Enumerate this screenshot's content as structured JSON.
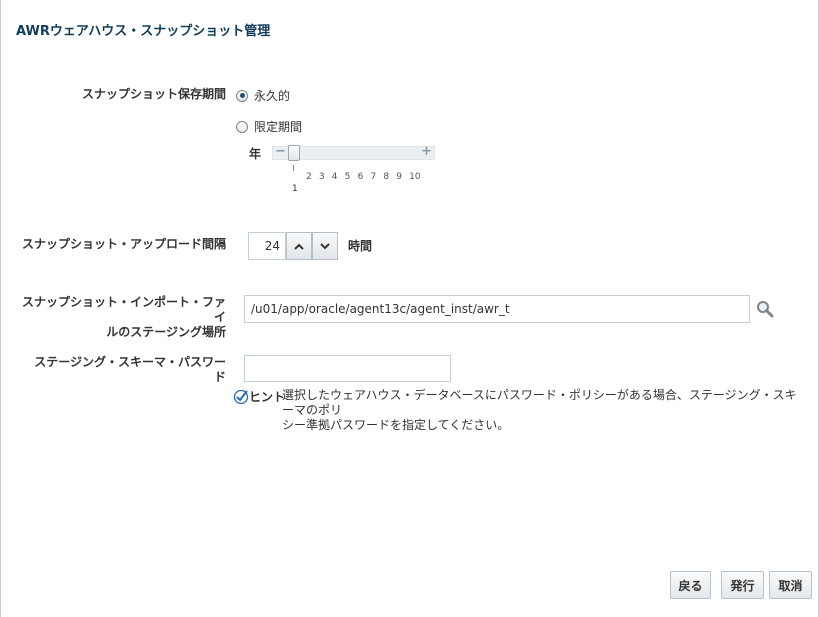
{
  "page": {
    "title": "AWRウェアハウス・スナップショット管理"
  },
  "retention": {
    "label": "スナップショット保存期間",
    "options": [
      {
        "label": "永久的",
        "selected": true
      },
      {
        "label": "限定期間",
        "selected": false
      }
    ],
    "slider": {
      "unit_label": "年",
      "minus_icon": "minus-icon",
      "plus_icon": "plus-icon",
      "ticks": [
        "2",
        "3",
        "4",
        "5",
        "6",
        "7",
        "8",
        "9",
        "10"
      ],
      "selected_value": "1"
    }
  },
  "upload_interval": {
    "label": "スナップショット・アップロード間隔",
    "value": "24",
    "unit": "時間"
  },
  "staging_location": {
    "label_line1": "スナップショット・インポート・ファイ",
    "label_line2": "ルのステージング場所",
    "value": "/u01/app/oracle/agent13c/agent_inst/awr_t",
    "search_icon": "magnifier-icon"
  },
  "staging_password": {
    "label_line1": "ステージング・スキーマ・パスワー",
    "label_line2": "ド",
    "value": ""
  },
  "hint": {
    "label": "ヒント",
    "text_line1": "選択したウェアハウス・データベースにパスワード・ポリシーがある場合、ステージング・スキーマのポリ",
    "text_line2": "シー準拠パスワードを指定してください。"
  },
  "buttons": {
    "back": "戻る",
    "submit": "発行",
    "cancel": "取消"
  },
  "colors": {
    "title": "#0f3c5a",
    "border": "#c4ced7",
    "radio_dot": "#1f4e79",
    "hint_check": "#2b6cb0"
  }
}
